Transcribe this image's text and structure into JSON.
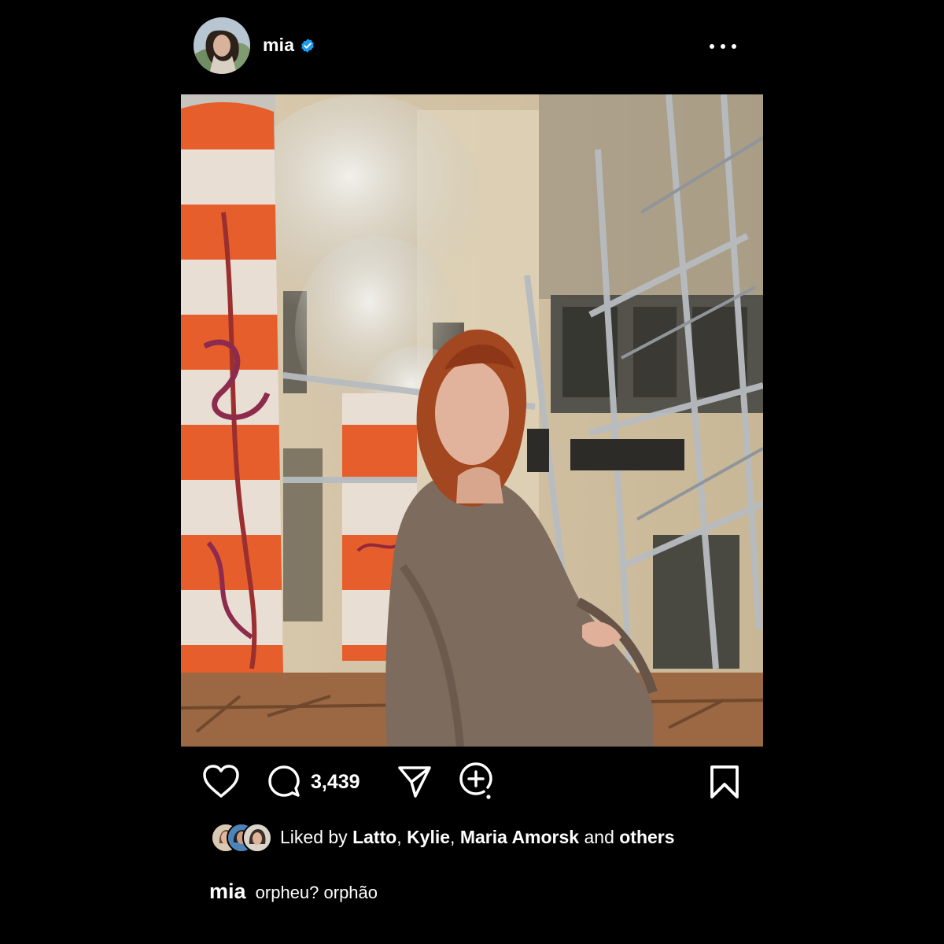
{
  "post": {
    "username": "mia",
    "verified": true,
    "image_alt": "Woman with red hair in a brown coat sitting on a wooden barrier beside orange-and-white striped steam stacks and scaffolding",
    "comment_count": "3,439",
    "likes": {
      "prefix": "Liked by",
      "users": [
        "Latto",
        "Kylie",
        "Maria Amorsk"
      ],
      "separator": ",",
      "conjunction": "and",
      "others": "others"
    },
    "caption": {
      "user": "mia",
      "text": "orpheu? orphão"
    }
  },
  "icons": {
    "verified": "verified-badge-icon",
    "more": "more-horizontal-icon",
    "like": "heart-icon",
    "comment": "comment-icon",
    "share": "send-icon",
    "remix": "add-comment-icon",
    "save": "bookmark-icon"
  },
  "colors": {
    "background": "#000000",
    "text": "#ffffff",
    "verified": "#1d9bf0"
  }
}
